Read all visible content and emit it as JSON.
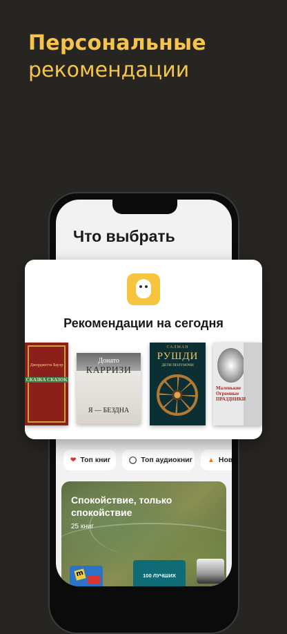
{
  "headline": {
    "line1": "Персональные",
    "line2": "рекомендации"
  },
  "screen": {
    "title": "Что выбрать"
  },
  "card": {
    "app_icon": "owl-app-icon",
    "title": "Рекомендации на сегодня",
    "books": [
      {
        "author": "Джорджетта Бауэр",
        "title": "СКАЗКА СКАЗОК"
      },
      {
        "author": "Донато",
        "title_top": "КАРРИЗИ",
        "title": "Я — БЕЗДНА"
      },
      {
        "author": "САЛМАН",
        "title_top": "РУШДИ",
        "title": "ДЕТИ ПОЛУНОЧИ"
      },
      {
        "title": "Маленькие Огромные ПРАЗДНИКИ"
      }
    ]
  },
  "chips": [
    {
      "icon": "heart-icon",
      "glyph": "❤",
      "label": "Топ книг"
    },
    {
      "icon": "headphones-icon",
      "glyph": "🎧",
      "label": "Топ аудиокниг"
    },
    {
      "icon": "fire-icon",
      "glyph": "🔥",
      "label": "Нов"
    }
  ],
  "collection": {
    "title": "Спокойствие, только спокойствие",
    "count": "25 книг",
    "mini_badge": "100 ЛУЧШИХ"
  },
  "colors": {
    "background": "#262521",
    "accent": "#f6c44d"
  }
}
